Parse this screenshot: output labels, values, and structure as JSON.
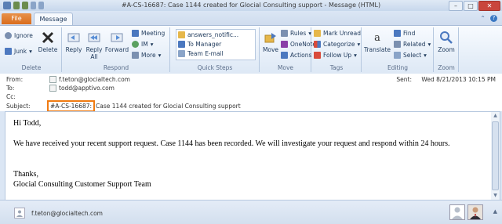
{
  "window": {
    "title": "#A-CS-16687: Case 1144 created for Glocial Consulting support  -  Message (HTML)",
    "controls": [
      "–",
      "□",
      "✕"
    ]
  },
  "tabs": {
    "file": "File",
    "message": "Message"
  },
  "ribbon": {
    "delete_group": {
      "label": "Delete",
      "ignore": "Ignore",
      "junk": "Junk",
      "delete": "Delete"
    },
    "respond_group": {
      "label": "Respond",
      "reply": "Reply",
      "reply_all": "Reply\nAll",
      "forward": "Forward",
      "meeting": "Meeting",
      "im": "IM",
      "more": "More"
    },
    "quick_steps": {
      "label": "Quick Steps",
      "items": [
        "answers_notific...",
        "To Manager",
        "Team E-mail"
      ]
    },
    "move_group": {
      "label": "Move",
      "move": "Move",
      "rules": "Rules",
      "onenote": "OneNote",
      "actions": "Actions"
    },
    "tags_group": {
      "label": "Tags",
      "mark_unread": "Mark Unread",
      "categorize": "Categorize",
      "follow_up": "Follow Up"
    },
    "editing_group": {
      "label": "Editing",
      "translate": "Translate",
      "find": "Find",
      "related": "Related",
      "select": "Select"
    },
    "zoom_group": {
      "label": "Zoom",
      "zoom": "Zoom"
    }
  },
  "header": {
    "from_label": "From:",
    "from": "f.teton@glocialtech.com",
    "to_label": "To:",
    "to": "todd@apptivo.com",
    "cc_label": "Cc:",
    "subject_label": "Subject:",
    "subject_tag": "#A-CS-16687:",
    "subject_rest": "Case 1144 created for Glocial Consulting support",
    "sent_label": "Sent:",
    "sent": "Wed 8/21/2013 10:15 PM"
  },
  "body": {
    "greeting": "Hi Todd,",
    "paragraph": "We have received your recent support request. Case 1144 has been recorded. We will investigate your request and respond within 24 hours.",
    "closing": "Thanks,",
    "signature": "Glocial Consulting Customer Support Team"
  },
  "people_pane": {
    "contact": "f.teton@glocialtech.com"
  },
  "colors": {
    "file_tab": "#d96d1c",
    "highlight": "#f07b12",
    "ribbon_bg": "#dde8f5"
  }
}
